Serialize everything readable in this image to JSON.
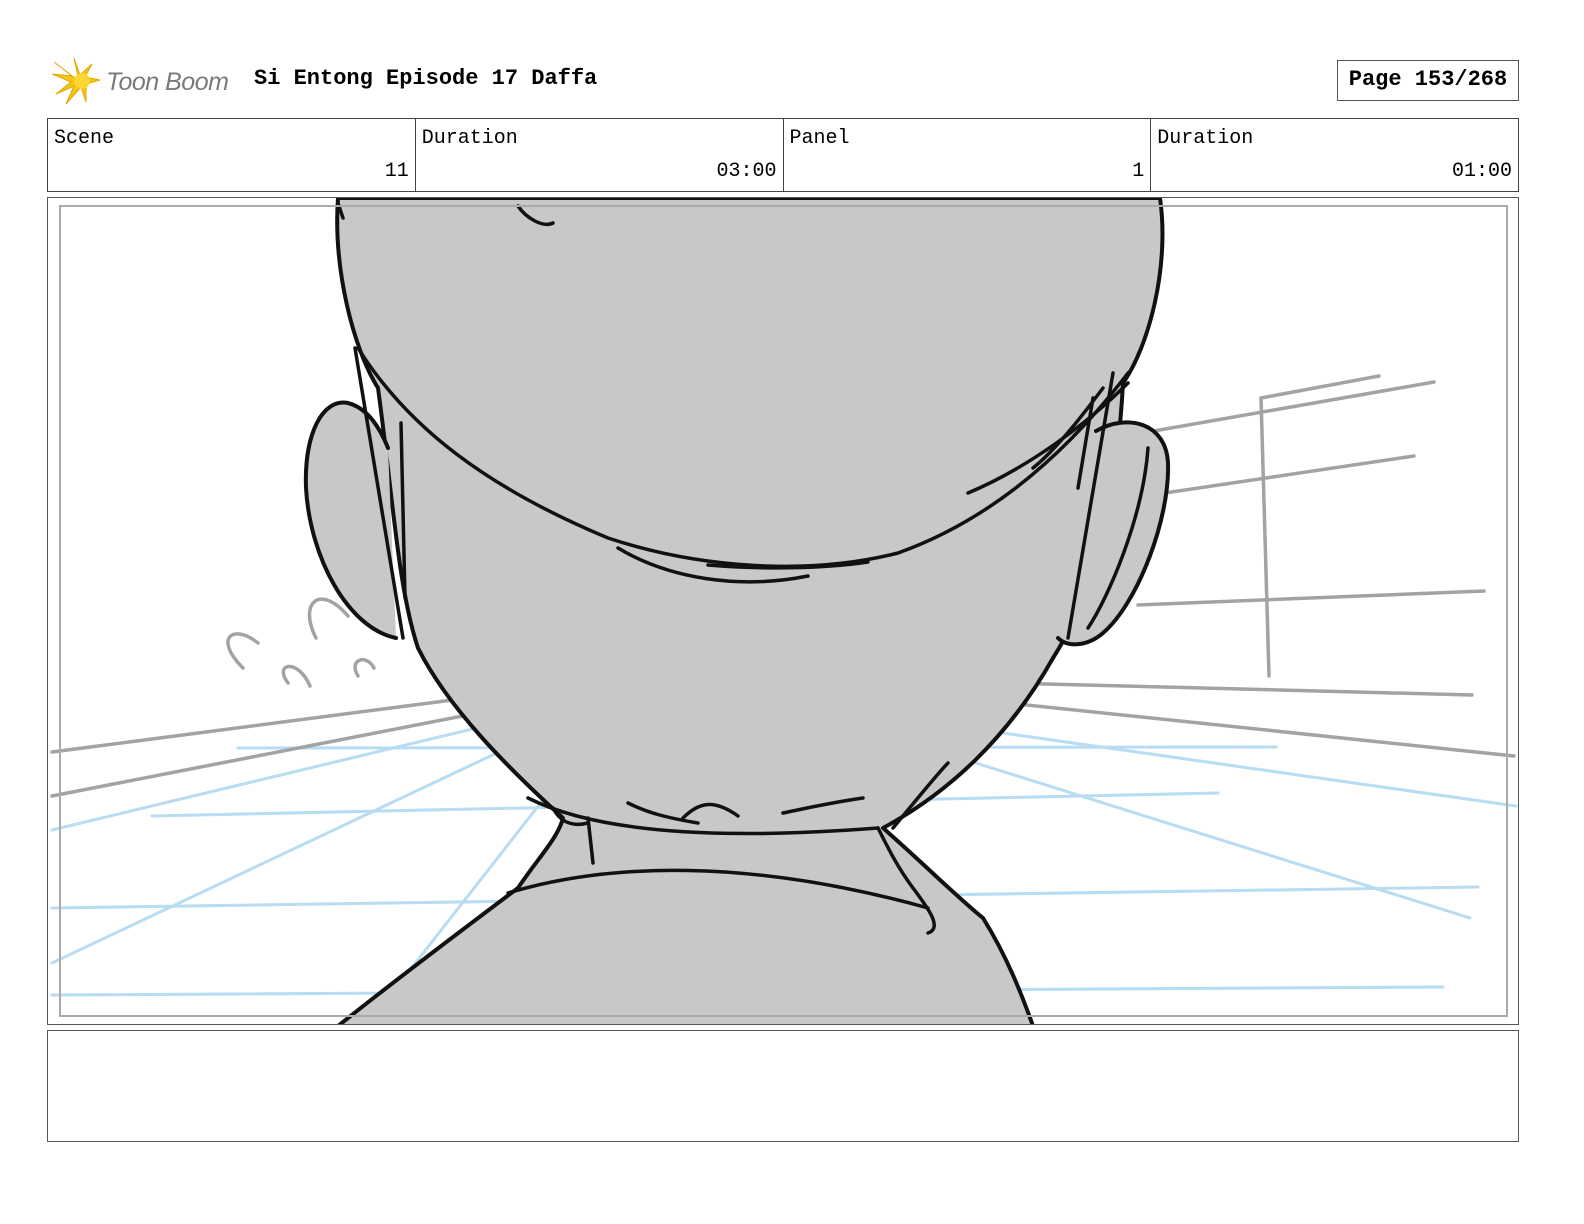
{
  "header": {
    "logo_text": "Toon Boom",
    "title": "Si Entong Episode 17 Daffa",
    "page": "Page 153/268"
  },
  "info": {
    "scene_label": "Scene",
    "scene_value": "11",
    "scene_duration_label": "Duration",
    "scene_duration_value": "03:00",
    "panel_label": "Panel",
    "panel_value": "1",
    "panel_duration_label": "Duration",
    "panel_duration_value": "01:00"
  },
  "panel": {
    "image": "storyboard-sketch-back-of-head",
    "colors": {
      "fill": "#c8c8c8",
      "ink": "#111111",
      "background_lines": "#a3a3a3",
      "floor_guides": "#b8dcf2"
    }
  },
  "notes": {
    "text": ""
  }
}
